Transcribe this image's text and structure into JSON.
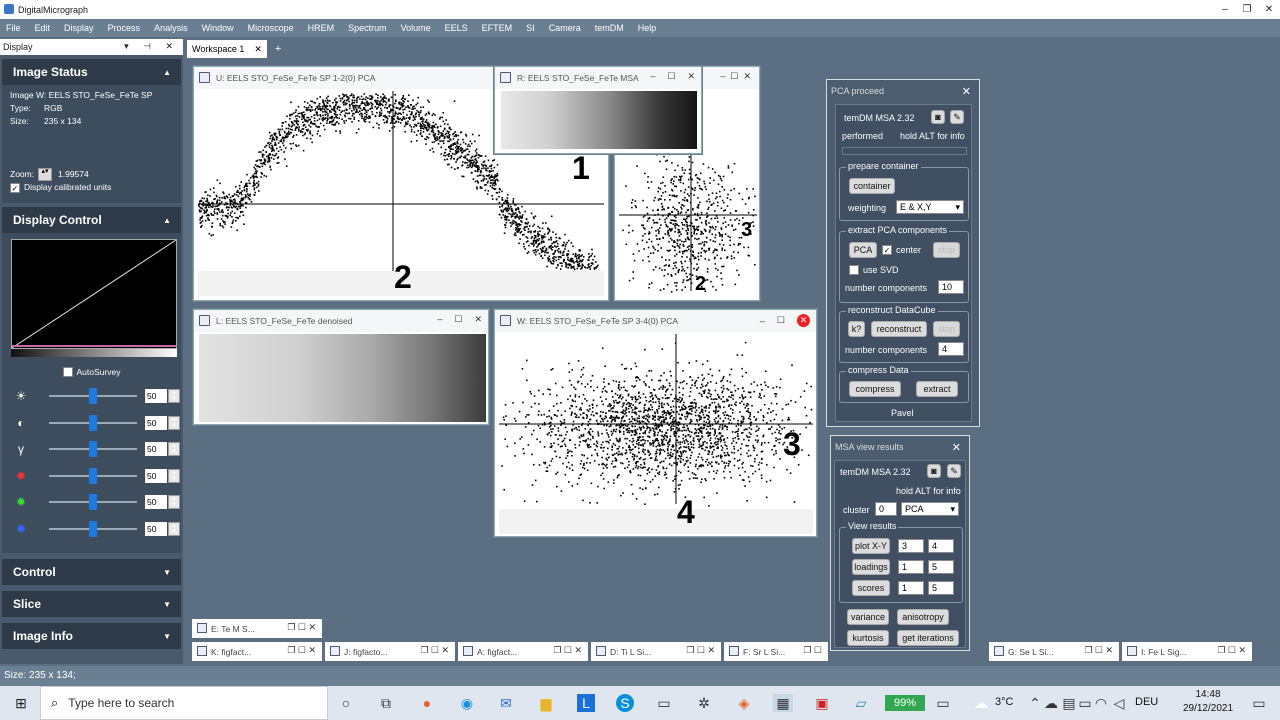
{
  "app": {
    "title": "DigitalMicrograph"
  },
  "menu": [
    "File",
    "Edit",
    "Display",
    "Process",
    "Analysis",
    "Window",
    "Microscope",
    "HREM",
    "Spectrum",
    "Volume",
    "EELS",
    "EFTEM",
    "SI",
    "Camera",
    "temDM",
    "Help"
  ],
  "left_panel": {
    "header": "Display",
    "image_status": {
      "title": "Image Status",
      "image_label": "Image W: EELS STO_FeSe_FeTe SP",
      "type_k": "Type:",
      "type_v": "RGB",
      "size_k": "Size:",
      "size_v": "235 x 134",
      "zoom_k": "Zoom:",
      "zoom_v": "1.99574",
      "calibrated": "Display calibrated units"
    },
    "display_control": {
      "title": "Display Control",
      "autosurvey": "AutoSurvey",
      "sliders": [
        "50",
        "50",
        "50",
        "50",
        "50",
        "50"
      ]
    },
    "collapsed": [
      "Control",
      "Slice",
      "Image Info"
    ]
  },
  "workspace": {
    "tab": "Workspace 1",
    "add": "+"
  },
  "windows": {
    "u": {
      "title": "U: EELS STO_FeSe_FeTe SP 1-2(0) PCA",
      "label": "2"
    },
    "r": {
      "title": "R: EELS STO_FeSe_FeTe MSA",
      "label": "1"
    },
    "v": {
      "label_a": "3",
      "label_b": "2"
    },
    "l": {
      "title": "L: EELS STO_FeSe_FeTe denoised"
    },
    "w": {
      "title": "W: EELS STO_FeSe_FeTe SP 3-4(0) PCA",
      "label_a": "3",
      "label_b": "4"
    }
  },
  "pca": {
    "title": "PCA proceed",
    "name": "temDM MSA 2.32",
    "performed": "performed",
    "hold": "hold ALT for info",
    "prepare": "prepare container",
    "container_btn": "container",
    "weighting": "weighting",
    "weighting_val": "E & X,Y",
    "extract": "extract PCA components",
    "pca_btn": "PCA",
    "center": "center",
    "stop": "stop",
    "use_svd": "use SVD",
    "num_comp": "number components",
    "num_comp_val": "10",
    "reconstruct": "reconstruct DataCube",
    "k_btn": "k?",
    "reconstruct_btn": "reconstruct",
    "stop2": "stop",
    "num_comp2": "number components",
    "num_comp2_val": "4",
    "compress": "compress Data",
    "compress_btn": "compress",
    "extract_btn": "extract",
    "author": "Pavel"
  },
  "msa": {
    "title": "MSA view results",
    "name": "temDM MSA 2.32",
    "hold": "hold ALT for info",
    "cluster": "cluster",
    "cluster_val": "0",
    "mode": "PCA",
    "view": "View results",
    "plotxy": "plot X-Y",
    "px1": "3",
    "px2": "4",
    "loadings": "loadings",
    "l1": "1",
    "l2": "5",
    "scores": "scores",
    "s1": "1",
    "s2": "5",
    "variance": "variance",
    "anisotropy": "anisotropy",
    "kurtosis": "kurtosis",
    "get_iterations": "get iterations"
  },
  "min_tabs": [
    "E: Te M S...",
    "K: figfact...",
    "J: figfacto...",
    "A: figfact...",
    "D: Ti L Si...",
    "F: Sr L Si...",
    "G: Se L Si...",
    "I: Fe L Sig..."
  ],
  "status": "Size: 235 x 134;",
  "taskbar": {
    "search": "Type here to search",
    "battery": "99%",
    "temp": "3°C",
    "lang": "DEU",
    "time": "14:48",
    "date": "29/12/2021"
  }
}
